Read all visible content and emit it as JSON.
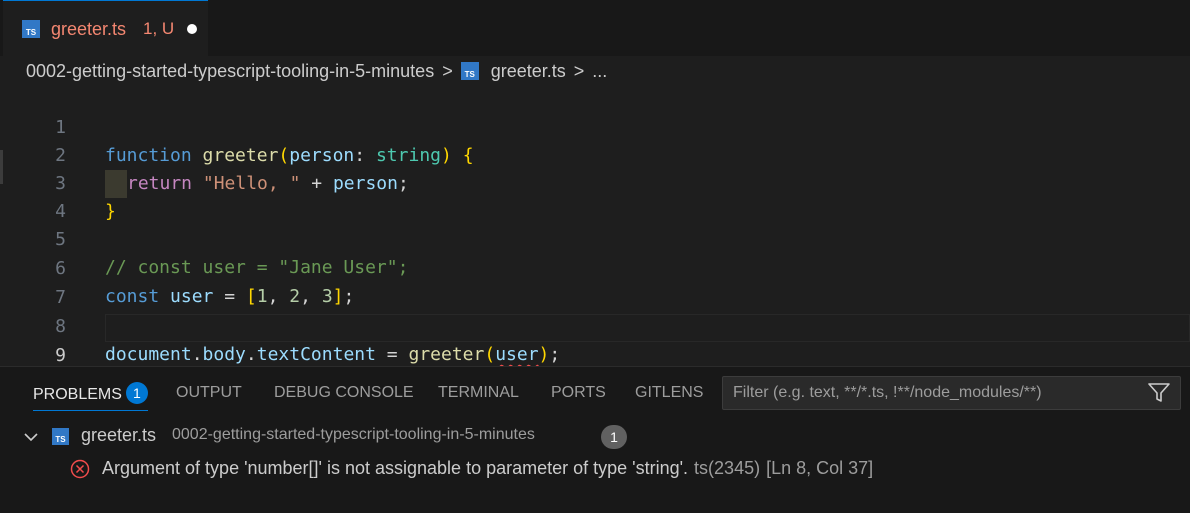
{
  "tab": {
    "icon": "typescript-file-icon",
    "icon_text": "TS",
    "name": "greeter.ts",
    "status": "1, U"
  },
  "breadcrumb": {
    "folder": "0002-getting-started-typescript-tooling-in-5-minutes",
    "file": "greeter.ts",
    "more": "..."
  },
  "editor": {
    "line_numbers": [
      "1",
      "2",
      "3",
      "4",
      "5",
      "6",
      "7",
      "8",
      "9"
    ],
    "lines": {
      "l1": {
        "kw": "function",
        "fn": "greeter",
        "open": "(",
        "param": "person",
        "colon": ": ",
        "type": "string",
        "close": ")",
        "brace": "{"
      },
      "l2": {
        "kw": "return",
        "str": "\"Hello, \"",
        "op": " + ",
        "var": "person",
        "semi": ";"
      },
      "l3": {
        "brace": "}"
      },
      "l5": {
        "comment": "// const user = \"Jane User\";"
      },
      "l6": {
        "kw": "const",
        "var": "user",
        "eq": " = ",
        "open": "[",
        "n1": "1",
        "c1": ", ",
        "n2": "2",
        "c2": ", ",
        "n3": "3",
        "close": "]",
        "semi": ";"
      },
      "l8": {
        "obj": "document",
        "d1": ".",
        "prop1": "body",
        "d2": ".",
        "prop2": "textContent",
        "eq": " = ",
        "fn": "greeter",
        "open": "(",
        "arg": "user",
        "close": ")",
        "semi": ";"
      }
    }
  },
  "panel": {
    "tabs": [
      "PROBLEMS",
      "OUTPUT",
      "DEBUG CONSOLE",
      "TERMINAL",
      "PORTS",
      "GITLENS"
    ],
    "problems_count": "1",
    "filter_placeholder": "Filter (e.g. text, **/*.ts, !**/node_modules/**)",
    "file_group": {
      "name": "greeter.ts",
      "path": "0002-getting-started-typescript-tooling-in-5-minutes",
      "count": "1"
    },
    "error": {
      "message": "Argument of type 'number[]' is not assignable to parameter of type 'string'.",
      "code": "ts(2345)",
      "location": "[Ln 8, Col 37]"
    }
  },
  "colors": {
    "accent": "#0078d4",
    "error": "#f14c4c",
    "modified_tab": "#f48771"
  }
}
